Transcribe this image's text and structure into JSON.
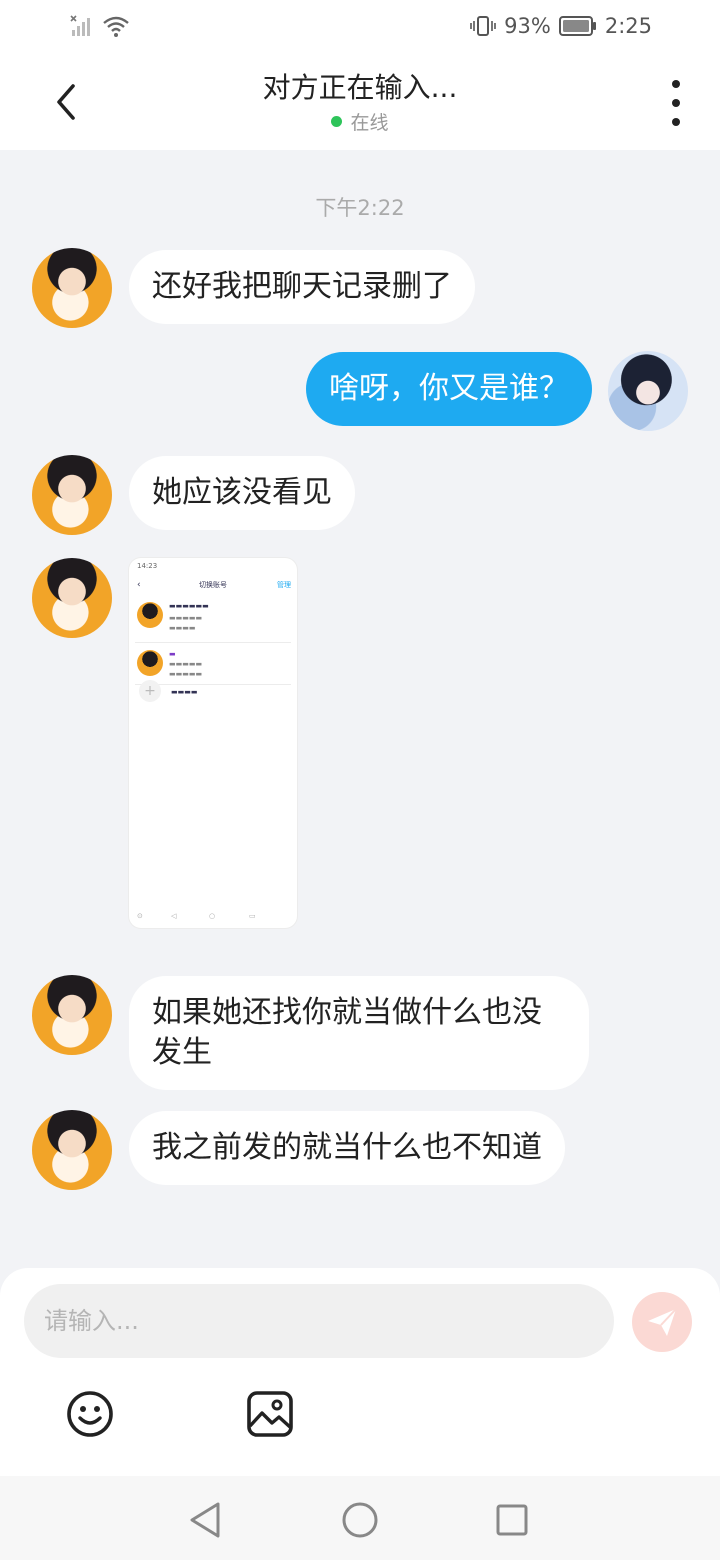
{
  "status_bar": {
    "battery_percent": "93%",
    "time": "2:25"
  },
  "header": {
    "title": "对方正在输入...",
    "status": "在线"
  },
  "chat": {
    "timestamp": "下午2:22",
    "messages": [
      {
        "from": "other",
        "text": "还好我把聊天记录删了"
      },
      {
        "from": "me",
        "text": "啥呀，你又是谁？"
      },
      {
        "from": "other",
        "text": "她应该没看见"
      },
      {
        "from": "other",
        "type": "image"
      },
      {
        "from": "other",
        "text": "如果她还找你就当做什么也没发生"
      },
      {
        "from": "other",
        "text": "我之前发的就当什么也不知道"
      }
    ]
  },
  "input": {
    "placeholder": "请输入..."
  },
  "colors": {
    "outgoing_bubble": "#1eaaf1",
    "online_dot": "#2ec45a",
    "send_button": "#fbd9d4"
  },
  "icons": [
    "back-icon",
    "more-icon",
    "send-icon",
    "emoji-icon",
    "image-icon",
    "nav-back-icon",
    "nav-home-icon",
    "nav-recents-icon"
  ]
}
